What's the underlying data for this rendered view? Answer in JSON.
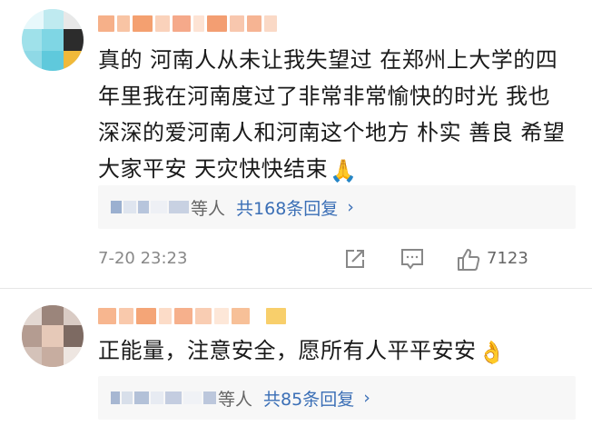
{
  "comments": [
    {
      "text": "真的 河南人从未让我失望过 在郑州上大学的四年里我在河南度过了非常非常愉快的时光 我也深深的爱河南人和河南这个地方 朴实 善良 希望大家平安 天灾快快结束",
      "emoji": "🙏",
      "replies_who": "等人",
      "replies_count": "共168条回复",
      "replies_chevron": "›",
      "time": "7-20 23:23",
      "likes": "7123"
    },
    {
      "text": "正能量，注意安全，愿所有人平平安安",
      "emoji": "👌",
      "replies_who": "等人",
      "replies_count": "共85条回复",
      "replies_chevron": "›"
    }
  ],
  "icons": {
    "share": "share-icon",
    "comment": "comment-icon",
    "like": "thumbs-up-icon"
  },
  "colors": {
    "link": "#3b6fb6",
    "muted": "#888888",
    "reply_bg": "#f7f7f7"
  }
}
